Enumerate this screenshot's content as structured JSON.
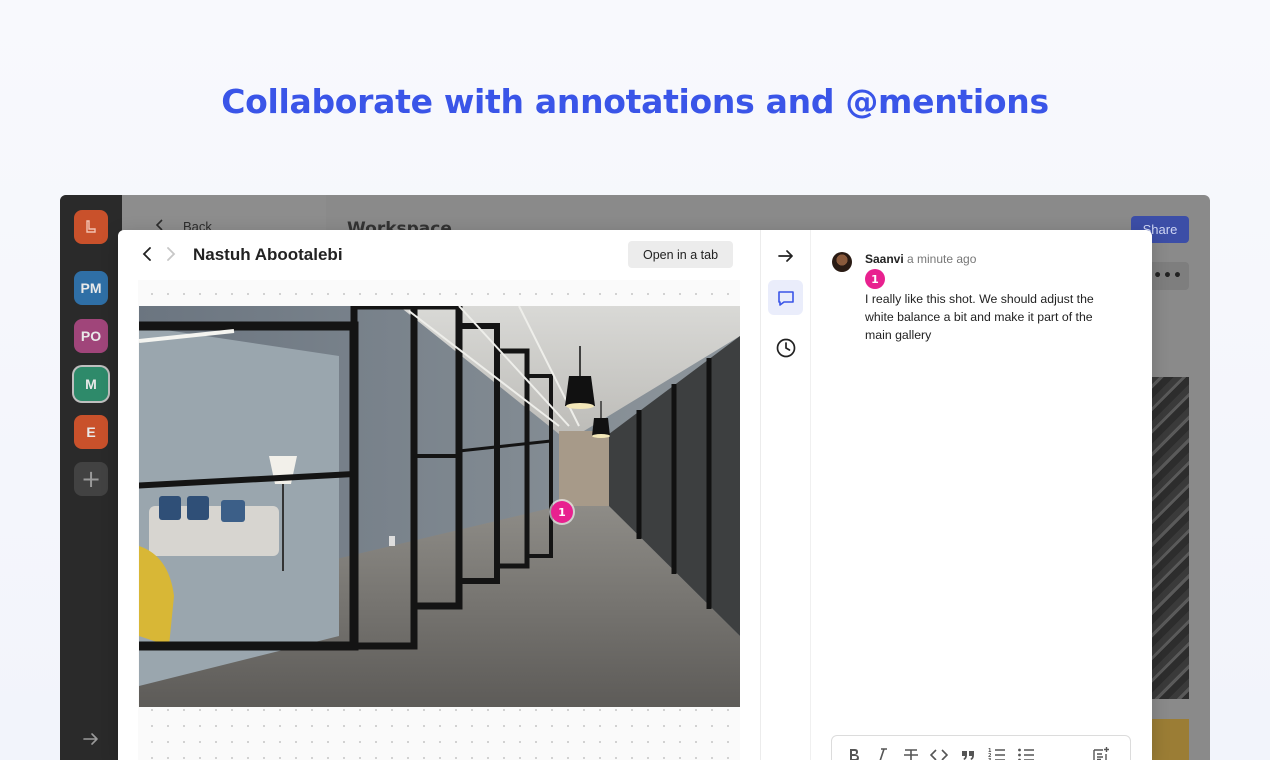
{
  "headline": "Collaborate with annotations and @mentions",
  "background_app": {
    "back_label": "Back",
    "workspace_title": "Workspace",
    "share_label": "Share",
    "more_label": "•••",
    "workspaces": [
      {
        "label": "",
        "color": "#c9512b"
      },
      {
        "label": "PM",
        "color": "#2f6fa6"
      },
      {
        "label": "PO",
        "color": "#a0457a"
      },
      {
        "label": "M",
        "color": "#2e8a6a"
      },
      {
        "label": "E",
        "color": "#c9512b"
      }
    ],
    "add_label": "+"
  },
  "viewer": {
    "title": "Nastuh Abootalebi",
    "open_tab_label": "Open in a tab",
    "pin_number": "1"
  },
  "comment": {
    "author": "Saanvi",
    "time": "a minute ago",
    "badge": "1",
    "text": "I really like this shot. We should adjust the white balance a bit and make it part of the main gallery"
  },
  "colors": {
    "accent": "#3a55e8",
    "pin": "#e8218f",
    "active_tool_bg": "#eaedfb"
  },
  "icons": {
    "tools": [
      "arrow-right-icon",
      "comment-icon",
      "clock-icon"
    ],
    "formatting": [
      "bold-icon",
      "italic-icon",
      "strikethrough-icon",
      "code-icon",
      "quote-icon",
      "ordered-list-icon",
      "bullet-list-icon",
      "add-note-icon"
    ]
  }
}
